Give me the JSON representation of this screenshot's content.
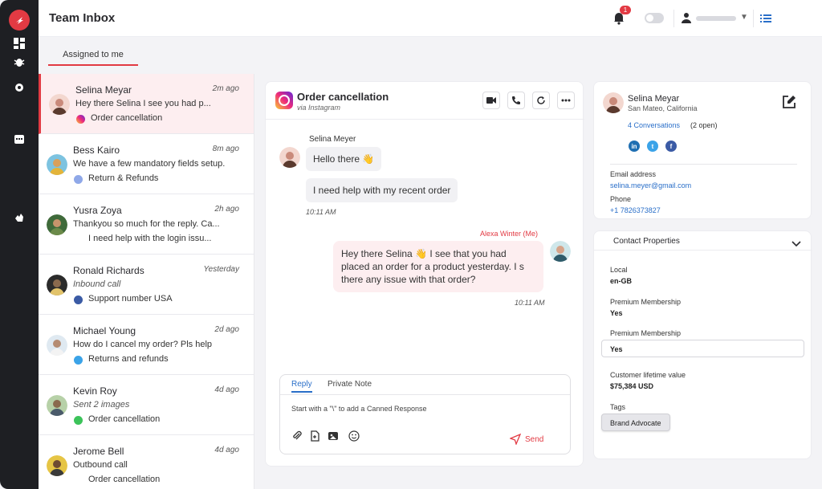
{
  "app": {
    "title": "Team Inbox",
    "notifications": "1"
  },
  "tabs": {
    "assigned": "Assigned to me"
  },
  "conversations": [
    {
      "name": "Selina Meyar",
      "time": "2m ago",
      "preview": "Hey there Selina    I see you had p...",
      "source": "Order cancellation",
      "source_icon": "instagram-icon",
      "avatar_color": "#c98a7a"
    },
    {
      "name": "Bess Kairo",
      "time": "8m ago",
      "preview": "We have a few mandatory fields setup.",
      "source": "Return & Refunds",
      "source_icon": "globe-icon",
      "avatar_color": "#d9a05b"
    },
    {
      "name": "Yusra Zoya",
      "time": "2h ago",
      "preview": "Thankyou so much for the reply. Ca...",
      "source": "I need help with the login issu...",
      "source_icon": "",
      "avatar_color": "#6b8a4a"
    },
    {
      "name": "Ronald Richards",
      "time": "Yesterday",
      "preview": "Inbound call",
      "source": "Support number USA",
      "source_icon": "facebook-icon",
      "avatar_color": "#6e5a3e"
    },
    {
      "name": "Michael Young",
      "time": "2d ago",
      "preview": "How do I cancel my order? Pls help",
      "source": "Returns and refunds",
      "source_icon": "twitter-icon",
      "avatar_color": "#b58c72"
    },
    {
      "name": "Kevin Roy",
      "time": "4d ago",
      "preview": "Sent 2 images",
      "source": "Order cancellation",
      "source_icon": "whatsapp-icon",
      "avatar_color": "#8a6a4e"
    },
    {
      "name": "Jerome Bell",
      "time": "4d ago",
      "preview": "Outbound call",
      "source": "Order cancellation",
      "source_icon": "",
      "avatar_color": "#c9a03a"
    }
  ],
  "chat": {
    "title": "Order cancellation",
    "via": "via Instagram",
    "sender": "Selina Meyer",
    "msg1": "Hello there 👋",
    "msg2": "I need help with my recent order",
    "time_in": "10:11 AM",
    "me_name": "Alexa Winter (Me)",
    "msg_out": "Hey there Selina 👋 I see that you had placed an order for a product yesterday. I s there any issue with that order?",
    "time_out": "10:11 AM"
  },
  "composer": {
    "tab_reply": "Reply",
    "tab_note": "Private Note",
    "placeholder": "Start with a \"\\\" to add a Canned Response",
    "send": "Send"
  },
  "contact": {
    "name": "Selina Meyar",
    "location": "San Mateo, California",
    "conversations": "4 Conversations",
    "open": "(2 open)",
    "email_label": "Email address",
    "email": "selina.meyer@gmail.com",
    "phone_label": "Phone",
    "phone": "+1 7826373827"
  },
  "props": {
    "title": "Contact Properties",
    "local_label": "Local",
    "local_value": "en-GB",
    "premium_label": "Premium Membership",
    "premium_value": "Yes",
    "premium2_label": "Premium Membership",
    "premium2_value": "Yes",
    "ltv_label": "Customer lifetime value",
    "ltv_value": "$75,384 USD",
    "tags_label": "Tags",
    "tag": "Brand Advocate"
  },
  "colors": {
    "accent": "#e23a43",
    "link": "#2a6fc9",
    "rail": "#1e1f23"
  }
}
